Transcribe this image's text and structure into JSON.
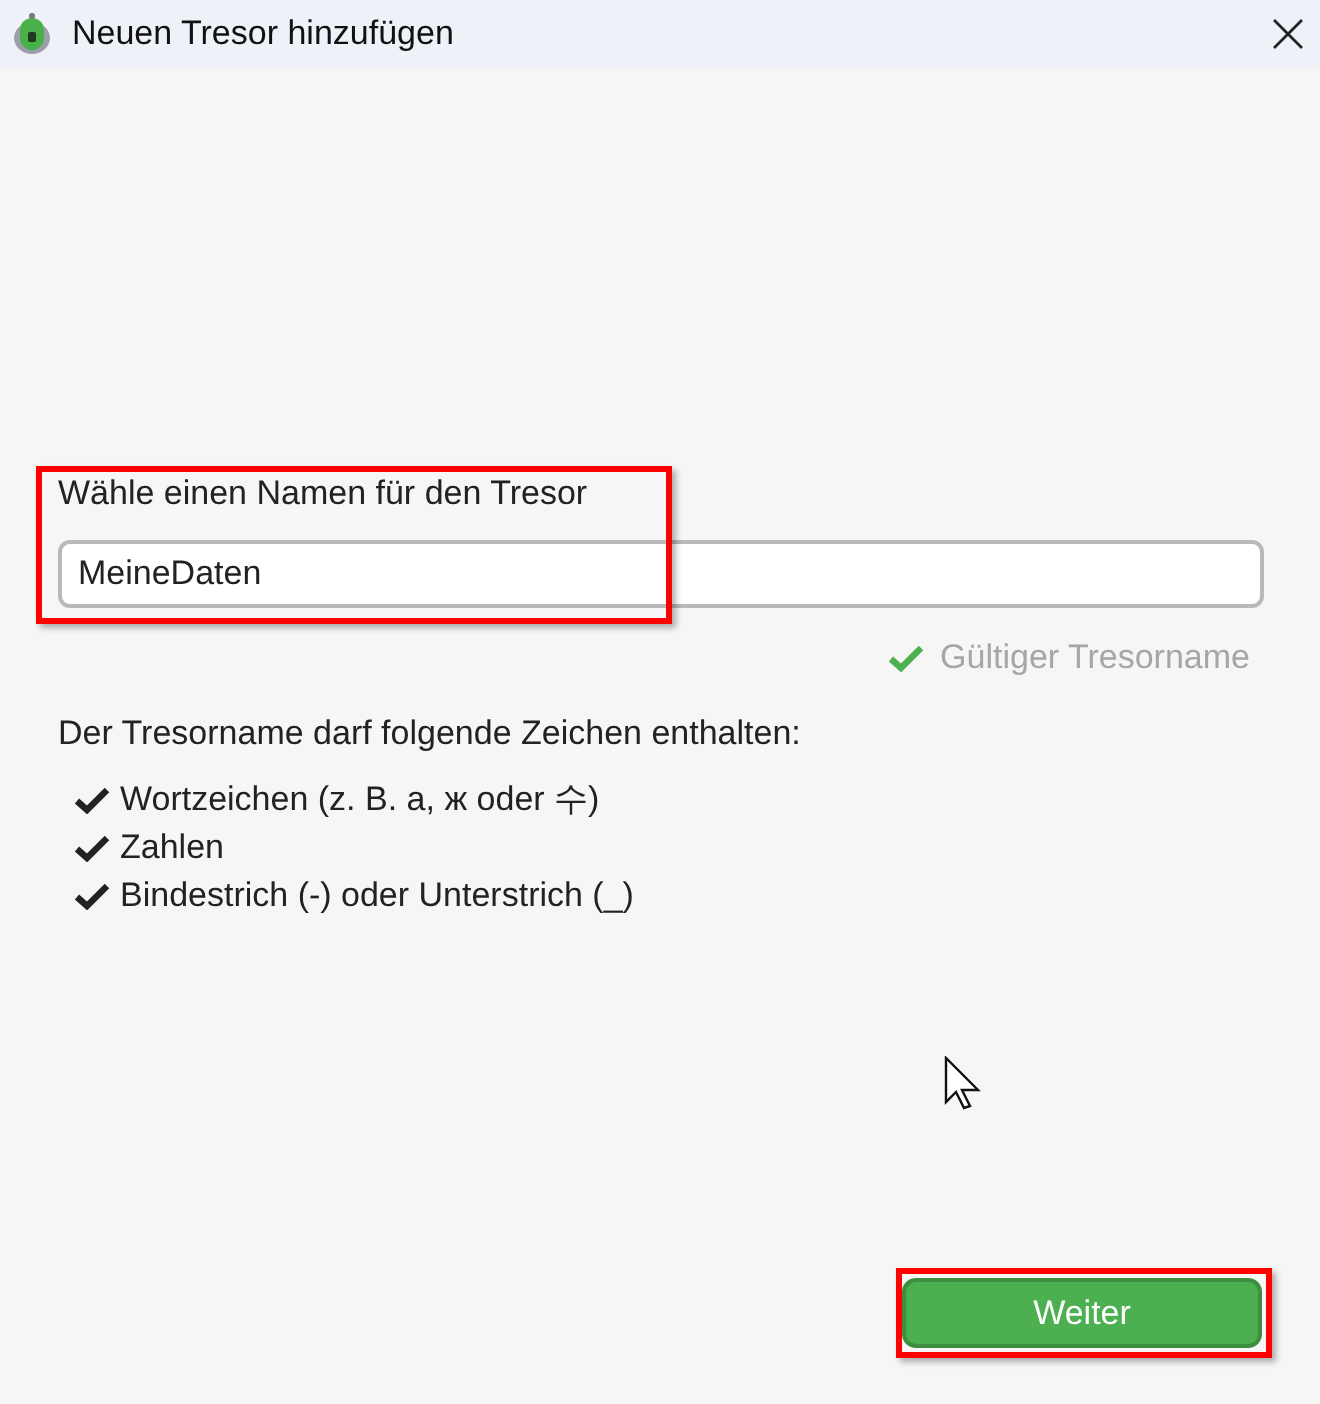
{
  "window": {
    "title": "Neuen Tresor hinzufügen"
  },
  "name_field": {
    "label": "Wähle einen Namen für den Tresor",
    "value": "MeineDaten"
  },
  "validation": {
    "valid": true,
    "message": "Gültiger Tresorname"
  },
  "rules": {
    "intro": "Der Tresorname darf folgende Zeichen enthalten:",
    "items": [
      "Wortzeichen (z. B. a, ж oder 수)",
      "Zahlen",
      "Bindestrich (-) oder Unterstrich (_)"
    ]
  },
  "next_button": {
    "label": "Weiter"
  }
}
